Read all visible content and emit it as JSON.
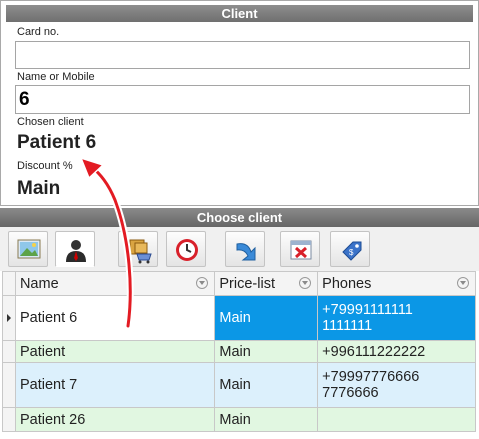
{
  "client": {
    "title": "Client",
    "card_label": "Card no.",
    "card_value": "",
    "name_label": "Name or Mobile",
    "name_value": "6",
    "chosen_label": "Chosen client",
    "chosen_value": "Patient 6",
    "discount_label": "Discount %",
    "discount_value": "Main"
  },
  "choose": {
    "title": "Choose client",
    "tools": [
      "photo-icon",
      "client-icon",
      "cart-icon",
      "clock-icon",
      "redo-icon",
      "delete-icon",
      "price-tag-icon"
    ],
    "columns": [
      "Name",
      "Price-list",
      "Phones"
    ],
    "rows": [
      {
        "name": "Patient 6",
        "price": "Main",
        "phone1": "+79991111111",
        "phone2": "1111111"
      },
      {
        "name": "Patient",
        "price": "Main",
        "phone1": "+996111222222",
        "phone2": ""
      },
      {
        "name": "Patient 7",
        "price": "Main",
        "phone1": "+79997776666",
        "phone2": "7776666"
      },
      {
        "name": "Patient 26",
        "price": "Main",
        "phone1": "",
        "phone2": ""
      }
    ]
  },
  "colors": {
    "selection": "#0b97e6",
    "row_blue": "#dcf0fc",
    "row_green": "#e1f7e1",
    "arrow": "#e31b23"
  }
}
